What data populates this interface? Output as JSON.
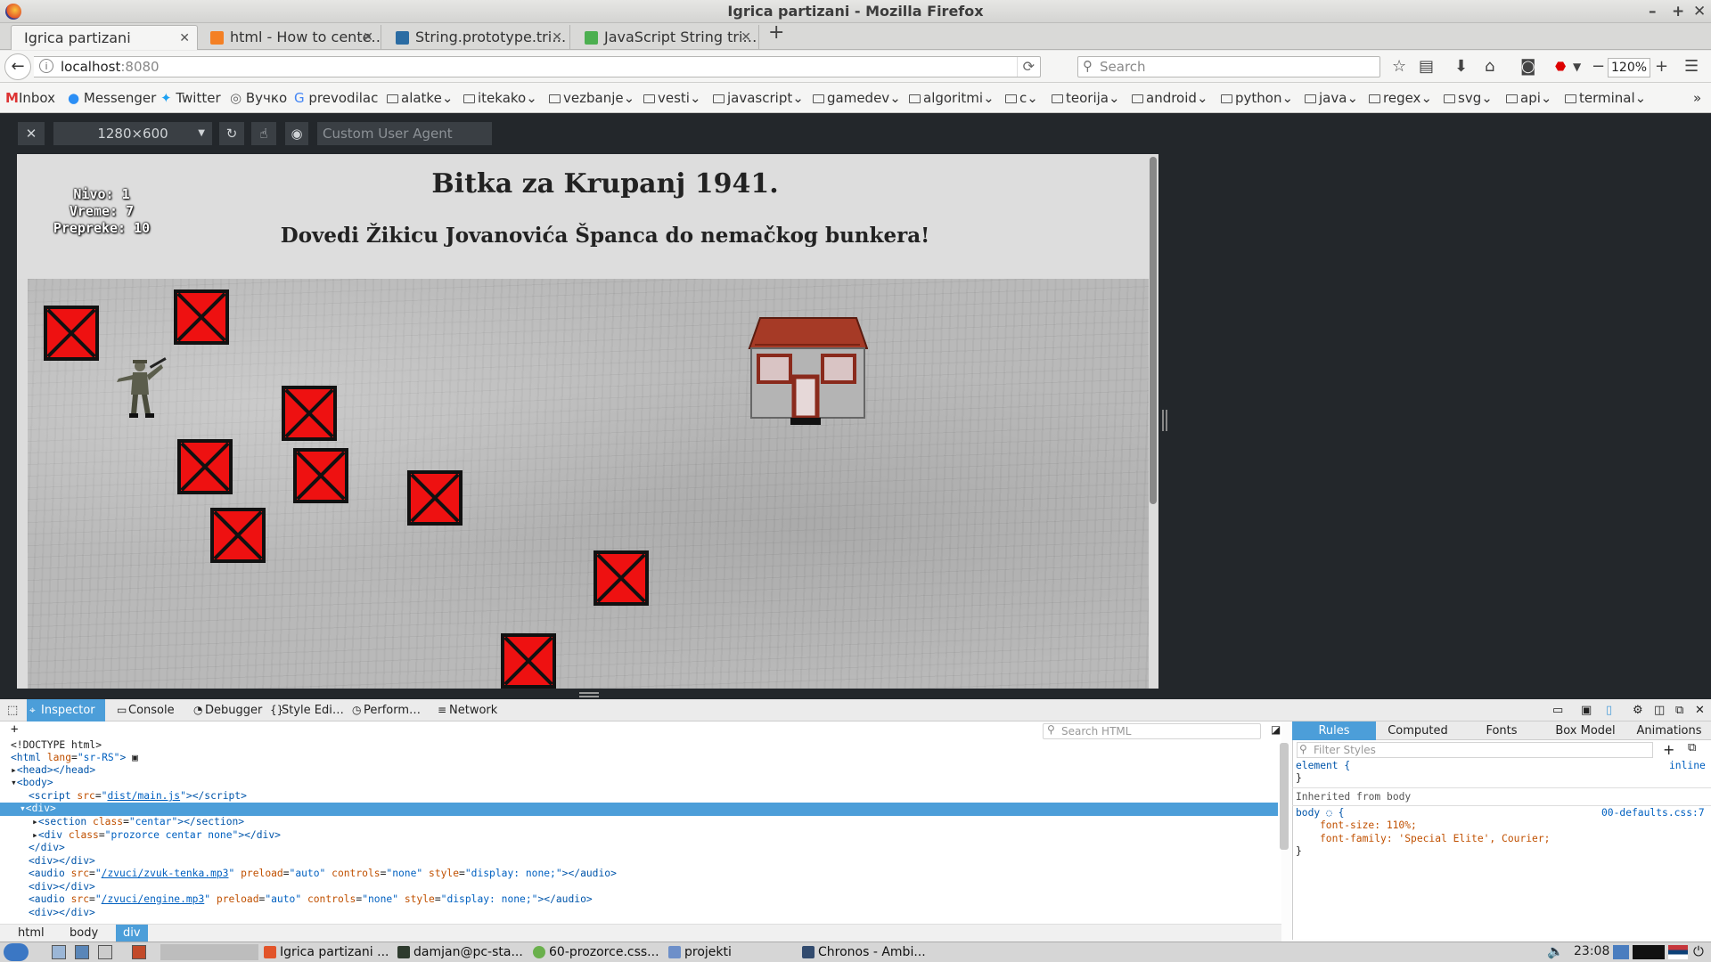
{
  "window": {
    "title": "Igrica partizani - Mozilla Firefox"
  },
  "tabs": [
    {
      "label": "Igrica partizani",
      "active": true
    },
    {
      "label": "html - How to cente…",
      "active": false
    },
    {
      "label": "String.prototype.tri…",
      "active": false
    },
    {
      "label": "JavaScript String tri…",
      "active": false
    }
  ],
  "url": {
    "host": "localhost",
    "port": ":8080"
  },
  "search": {
    "placeholder": "Search"
  },
  "zoom": "120%",
  "bookmarks": [
    {
      "label": "Inbox",
      "type": "link"
    },
    {
      "label": "Messenger",
      "type": "link"
    },
    {
      "label": "Twitter",
      "type": "link"
    },
    {
      "label": "Вучко",
      "type": "link"
    },
    {
      "label": "prevodilac",
      "type": "link"
    },
    {
      "label": "alatke",
      "type": "folder"
    },
    {
      "label": "itekako",
      "type": "folder"
    },
    {
      "label": "vezbanje",
      "type": "folder"
    },
    {
      "label": "vesti",
      "type": "folder"
    },
    {
      "label": "javascript",
      "type": "folder"
    },
    {
      "label": "gamedev",
      "type": "folder"
    },
    {
      "label": "algoritmi",
      "type": "folder"
    },
    {
      "label": "c",
      "type": "folder"
    },
    {
      "label": "teorija",
      "type": "folder"
    },
    {
      "label": "android",
      "type": "folder"
    },
    {
      "label": "python",
      "type": "folder"
    },
    {
      "label": "java",
      "type": "folder"
    },
    {
      "label": "regex",
      "type": "folder"
    },
    {
      "label": "svg",
      "type": "folder"
    },
    {
      "label": "api",
      "type": "folder"
    },
    {
      "label": "terminal",
      "type": "folder"
    }
  ],
  "rdm": {
    "size": "1280×600",
    "user_agent_placeholder": "Custom User Agent"
  },
  "game": {
    "level": "Nivo: 1",
    "time": "Vreme: 7",
    "obstacles": "Prepreke: 10",
    "title": "Bitka za Krupanj 1941.",
    "subtitle": "Dovedi Žikicu Jovanovića Španca do nemačkog bunkera!"
  },
  "devtools": {
    "tabs": [
      "Inspector",
      "Console",
      "Debugger",
      "Style Edi…",
      "Perform…",
      "Network"
    ],
    "search_placeholder": "Search HTML",
    "side_tabs": [
      "Rules",
      "Computed",
      "Fonts",
      "Box Model",
      "Animations"
    ],
    "filter_placeholder": "Filter Styles",
    "breadcrumbs": [
      "html",
      "body",
      "div"
    ],
    "rules": {
      "element_selector": "element {",
      "element_source": "inline",
      "element_close": "}",
      "inherited": "Inherited from body",
      "body_selector": "body",
      "body_source": "00-defaults.css:7",
      "prop1": "font-size: 110%;",
      "prop2": "font-family: 'Special Elite', Courier;",
      "body_close": "}"
    }
  },
  "taskbar": {
    "items": [
      "Igrica partizani ...",
      "damjan@pc-sta...",
      "60-prozorce.css...",
      "projekti",
      "Chronos - Ambi..."
    ],
    "clock": "23:08"
  }
}
